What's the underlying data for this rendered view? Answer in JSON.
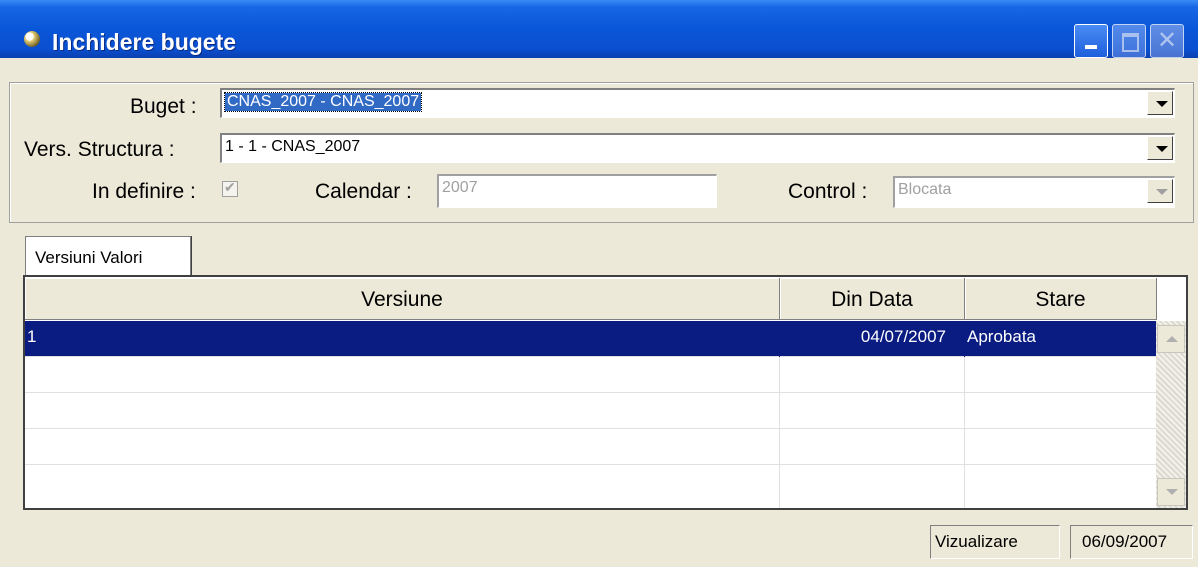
{
  "window": {
    "title": "Inchidere bugete"
  },
  "form": {
    "buget": {
      "label": "Buget :",
      "value": "CNAS_2007 - CNAS_2007"
    },
    "structura": {
      "label": "Vers. Structura :",
      "value": "1 - 1 - CNAS_2007"
    },
    "in_definire": {
      "label": "In definire :",
      "checked": true
    },
    "calendar": {
      "label": "Calendar :",
      "value": "2007"
    },
    "control": {
      "label": "Control :",
      "value": "Blocata"
    }
  },
  "tabs": [
    {
      "label": "Versiuni Valori"
    }
  ],
  "grid": {
    "columns": [
      "Versiune",
      "Din Data",
      "Stare"
    ],
    "rows": [
      {
        "versiune": "1",
        "din_data": "04/07/2007",
        "stare": "Aprobata"
      }
    ]
  },
  "status": {
    "mode": "Vizualizare",
    "date": "06/09/2007"
  },
  "colors": {
    "titlebar": "#0a56d8",
    "selection": "#0a1c82",
    "highlight": "#316ac5",
    "window_bg": "#ece9d8"
  },
  "icons": [
    "app-icon",
    "minimize-icon",
    "maximize-icon",
    "close-icon",
    "dropdown-arrow-icon",
    "scroll-up-icon",
    "scroll-down-icon"
  ]
}
